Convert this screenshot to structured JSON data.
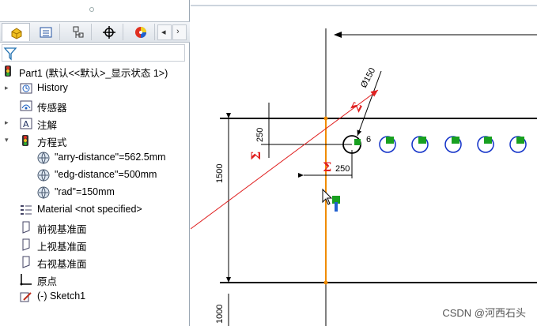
{
  "feature_tree": {
    "part": {
      "label": "Part1  (默认<<默认>_显示状态 1>)"
    },
    "items": [
      {
        "label": "History",
        "icon": "history-icon",
        "expandable": true
      },
      {
        "label": "传感器",
        "icon": "sensor-icon",
        "expandable": false
      },
      {
        "label": "注解",
        "icon": "annotation-icon",
        "expandable": true
      },
      {
        "label": "方程式",
        "icon": "equations-folder-icon",
        "expandable": true,
        "expanded": true
      },
      {
        "label": "\"arry-distance\"=562.5mm",
        "icon": "global-variable-icon",
        "child": true
      },
      {
        "label": "\"edg-distance\"=500mm",
        "icon": "global-variable-icon",
        "child": true
      },
      {
        "label": "\"rad\"=150mm",
        "icon": "global-variable-icon",
        "child": true
      },
      {
        "label": "Material <not specified>",
        "icon": "material-icon"
      },
      {
        "label": "前视基准面",
        "icon": "plane-icon"
      },
      {
        "label": "上视基准面",
        "icon": "plane-icon"
      },
      {
        "label": "右视基准面",
        "icon": "plane-icon"
      },
      {
        "label": "原点",
        "icon": "origin-icon"
      },
      {
        "label": "(-) Sketch1",
        "icon": "sketch-icon"
      }
    ]
  },
  "tabs": [
    "feature-manager",
    "property-manager",
    "configuration-manager",
    "dimxpert-manager",
    "display-manager"
  ],
  "scroll_buttons": {
    "left": "◂",
    "right": "›"
  },
  "drawing": {
    "dim_diameter": "Ø150",
    "dim_count": "6",
    "dim_v_small": "250",
    "dim_h_small": "250",
    "dim_v_large": "1500",
    "dim_v_bottom": "1000",
    "equation_mark": "Σ"
  },
  "watermark": "CSDN @河西石头",
  "colors": {
    "accent": "#e02020",
    "edge_highlight": "#f08c00",
    "circle": "#1030c8",
    "relation": "#18a020"
  }
}
